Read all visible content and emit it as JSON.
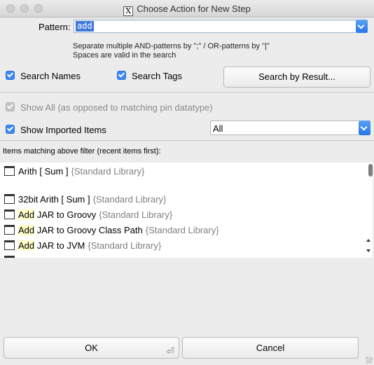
{
  "window": {
    "title": "Choose Action for New Step",
    "app_icon": "x-window-icon"
  },
  "filter": {
    "pattern_label": "Pattern:",
    "pattern_value": "add",
    "help_line1": "Separate multiple AND-patterns by \";\" / OR-patterns by \"|\"",
    "help_line2": "Spaces are valid in the search"
  },
  "options": {
    "search_names": {
      "label": "Search Names",
      "checked": true
    },
    "search_tags": {
      "label": "Search Tags",
      "checked": true
    },
    "search_by_result": "Search by Result...",
    "show_all": {
      "label": "Show All (as opposed to matching pin datatype)",
      "checked": true,
      "disabled": true
    },
    "show_imported": {
      "label": "Show Imported Items",
      "checked": true
    },
    "scope_select": "All"
  },
  "list": {
    "header": "Items matching above filter (recent items first):",
    "items": [
      {
        "prefix": "Arith [ Sum ]",
        "match": "",
        "suffix": "",
        "library": "{Standard Library}"
      },
      {
        "prefix": "32bit Arith [ Sum ]",
        "match": "",
        "suffix": "",
        "library": "{Standard Library}"
      },
      {
        "prefix": "",
        "match": "Add",
        "suffix": " JAR to Groovy",
        "library": "{Standard Library}"
      },
      {
        "prefix": "",
        "match": "Add",
        "suffix": " JAR to Groovy Class Path",
        "library": "{Standard Library}"
      },
      {
        "prefix": "",
        "match": "Add",
        "suffix": " JAR to JVM",
        "library": "{Standard Library}"
      }
    ]
  },
  "buttons": {
    "ok": "OK",
    "cancel": "Cancel"
  },
  "colors": {
    "accent": "#3c89f5",
    "match_highlight": "#fffcc7",
    "library_text": "#808080"
  }
}
